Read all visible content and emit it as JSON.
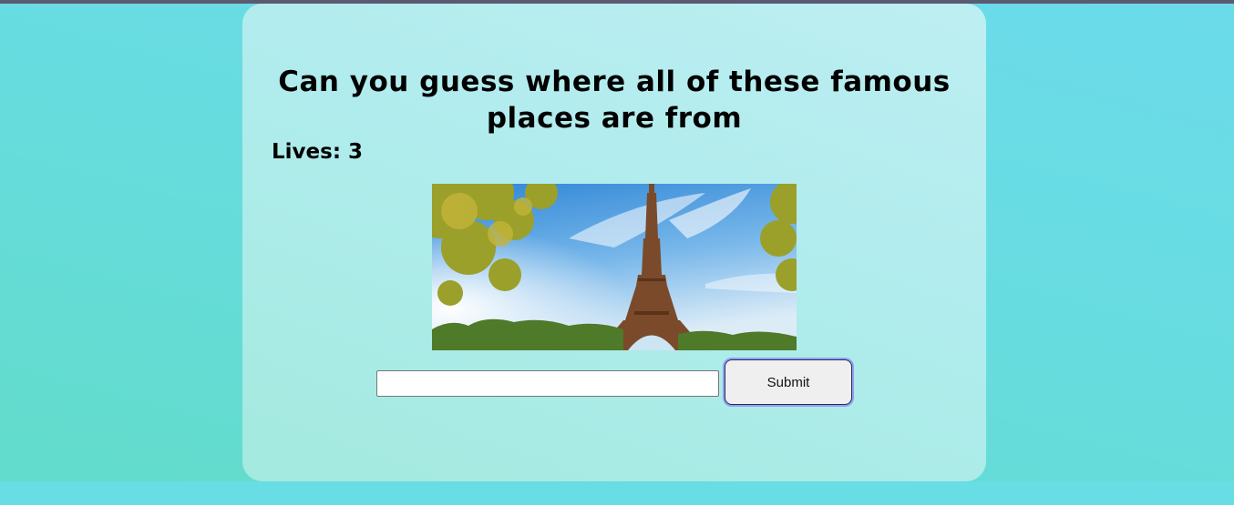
{
  "quiz": {
    "title": "Can you guess where all of these famous places are from",
    "lives_text": "Lives: 3",
    "image_subject": "eiffel-tower",
    "answer_input": {
      "value": "",
      "placeholder": ""
    },
    "submit_label": "Submit"
  },
  "colors": {
    "page_background": "#66dcdf",
    "card_background": "#b2eced",
    "top_bar": "#5a5a72",
    "submit_focus_ring": "#8fa0f2"
  }
}
